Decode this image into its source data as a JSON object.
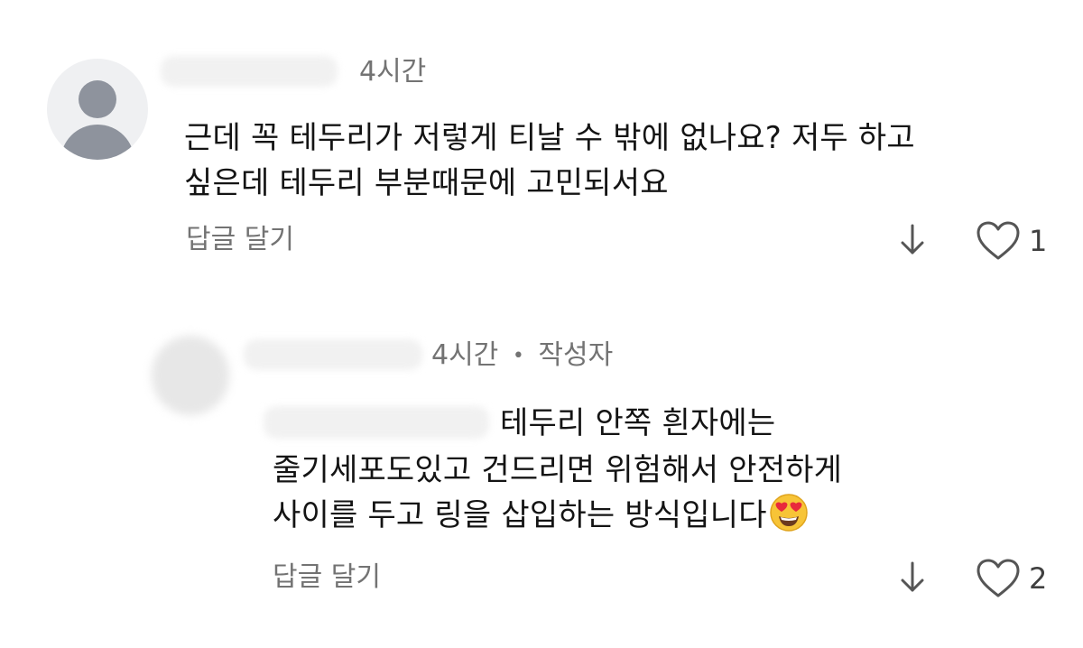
{
  "comments": [
    {
      "time": "4시간",
      "text_lines": [
        "근데 꼭 테두리가 저렇게 티날 수 밖에 없나요? 저두 하고",
        "싶은데 테두리 부분때문에 고민되서요"
      ],
      "reply_label": "답글 달기",
      "like_count": "1"
    },
    {
      "time": "4시간",
      "separator": "•",
      "author_badge": "작성자",
      "text_lines": [
        "테두리 안쪽 흰자에는",
        "줄기세포도있고 건드리면 위험해서 안전하게",
        "사이를 두고 링을 삽입하는 방식입니다"
      ],
      "reply_label": "답글 달기",
      "like_count": "2",
      "trailing_emoji": "heart-eyes-emoji"
    }
  ],
  "icons": {
    "download": "down-arrow-icon",
    "like": "heart-icon"
  },
  "colors": {
    "meta_text": "#737373",
    "avatar_bg": "#eff0f2",
    "avatar_fg": "#8e939d"
  }
}
